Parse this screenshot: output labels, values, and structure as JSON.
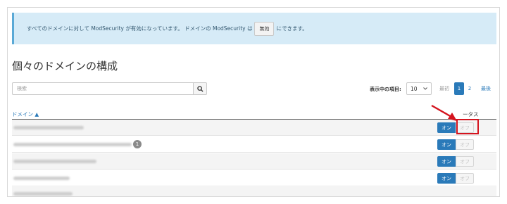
{
  "alert": {
    "text_before": "すべてのドメインに対して ModSecurity が有効になっています。 ドメインの ModSecurity は",
    "chip_label": "無効",
    "text_after": "にできます。"
  },
  "page_title": "個々のドメインの構成",
  "search": {
    "placeholder": "検索"
  },
  "pagination": {
    "per_page_label": "表示中の項目:",
    "per_page_value": "10",
    "first_label": "最初",
    "pages": [
      "1",
      "2"
    ],
    "last_label": "最後"
  },
  "table": {
    "domain_header": "ドメイン ▲",
    "status_header": "ータス",
    "rows": [
      {
        "badge": "",
        "on_label": "オン",
        "off_label": "オフ"
      },
      {
        "badge": "1",
        "on_label": "オン",
        "off_label": "オフ"
      },
      {
        "badge": "",
        "on_label": "オン",
        "off_label": "オフ"
      },
      {
        "badge": "",
        "on_label": "オン",
        "off_label": "オフ"
      }
    ]
  },
  "colors": {
    "accent": "#2a7ab9",
    "alert_bg": "#d6ebf7",
    "annotation": "#d4141e"
  },
  "icons": {
    "search_button": "magnifier-icon",
    "select": "chevron-down-icon",
    "annotation": "red-arrow-icon"
  }
}
